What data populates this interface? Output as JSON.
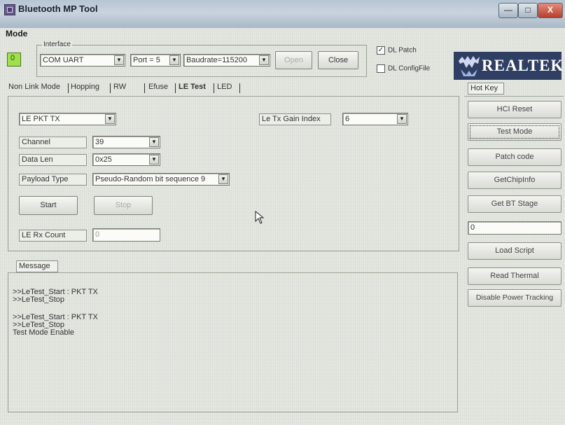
{
  "window": {
    "title": "Bluetooth MP Tool",
    "controls": {
      "minimize": "—",
      "maximize": "□",
      "close": "X"
    }
  },
  "menu": {
    "mode": "Mode"
  },
  "interface": {
    "group_label": "Interface",
    "status_led_text": "0",
    "comport": "COM UART",
    "port": "Port = 5",
    "baudrate": "Baudrate=115200",
    "open_label": "Open",
    "close_label": "Close",
    "dl_patch_label": "DL Patch",
    "dl_patch_checked": true,
    "dl_configfile_label": "DL ConfigFile",
    "dl_configfile_checked": false
  },
  "logo": {
    "text": "REALTEK"
  },
  "tabs": [
    {
      "label": "Non Link Mode"
    },
    {
      "label": "Hopping"
    },
    {
      "label": "RW"
    },
    {
      "label": "Efuse"
    },
    {
      "label": "LE Test"
    },
    {
      "label": "LED"
    }
  ],
  "le_test": {
    "mode_select": "LE PKT TX",
    "gain_index_label": "Le Tx Gain Index",
    "gain_index_value": "6",
    "channel_label": "Channel",
    "channel_value": "39",
    "data_len_label": "Data Len",
    "data_len_value": "0x25",
    "payload_type_label": "Payload Type",
    "payload_type_value": "Pseudo-Random bit sequence 9",
    "start_label": "Start",
    "stop_label": "Stop",
    "rx_count_label": "LE Rx Count",
    "rx_count_value": "0"
  },
  "message": {
    "tab_label": "Message",
    "lines": [
      ">>LeTest_Start : PKT TX",
      ">>LeTest_Stop",
      "",
      ">>LeTest_Start : PKT TX",
      ">>LeTest_Stop",
      "Test Mode Enable"
    ]
  },
  "hotkey": {
    "label": "Hot Key",
    "buttons": {
      "hci_reset": "HCI Reset",
      "test_mode": "Test Mode",
      "patch_code": "Patch code",
      "get_chip_info": "GetChipInfo",
      "get_bt_stage": "Get BT Stage"
    },
    "value_field": "0",
    "buttons_lower": {
      "load_script": "Load Script",
      "read_thermal": "Read Thermal",
      "disable_power_tracking": "Disable Power Tracking"
    }
  }
}
